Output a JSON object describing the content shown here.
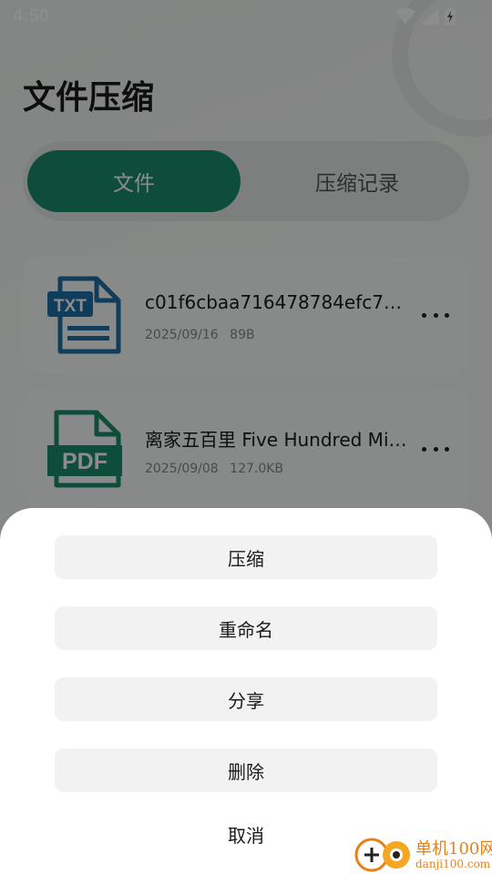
{
  "status_bar": {
    "time": "4:50"
  },
  "header": {
    "title": "文件压缩"
  },
  "tabs": [
    {
      "label": "文件",
      "active": true
    },
    {
      "label": "压缩记录",
      "active": false
    }
  ],
  "files": [
    {
      "name": "c01f6cbaa716478784efc709...",
      "date": "2025/09/16",
      "size": "89B",
      "type": "TXT"
    },
    {
      "name": "离家五百里 Five Hundred Mil...",
      "date": "2025/09/08",
      "size": "127.0KB",
      "type": "PDF"
    }
  ],
  "action_sheet": {
    "compress_label": "压缩",
    "rename_label": "重命名",
    "share_label": "分享",
    "delete_label": "删除",
    "cancel_label": "取消"
  },
  "watermark": {
    "name": "单机100网",
    "url": "danji100.com"
  },
  "colors": {
    "accent": "#1b8a6e",
    "txt_icon": "#1e6fa8",
    "pdf_icon": "#1b8a6e",
    "brand": "#e8801a"
  }
}
